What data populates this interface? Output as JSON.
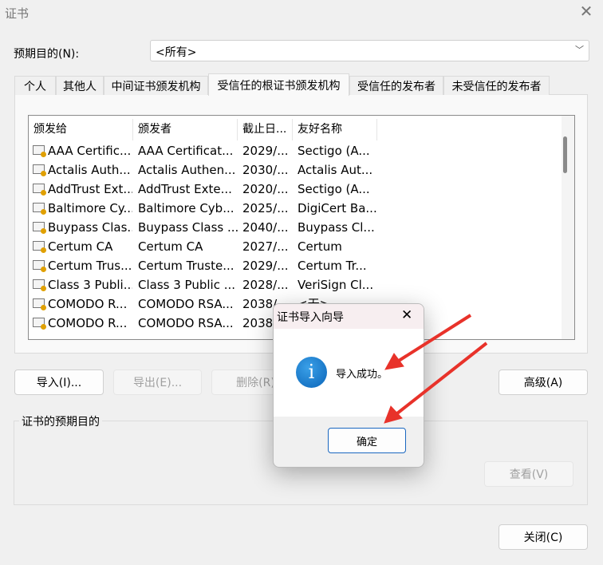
{
  "window": {
    "title": "证书",
    "close": "✕"
  },
  "purpose": {
    "label": "预期目的(N):",
    "value": "<所有>"
  },
  "tabs": [
    {
      "label": "个人"
    },
    {
      "label": "其他人"
    },
    {
      "label": "中间证书颁发机构"
    },
    {
      "label": "受信任的根证书颁发机构"
    },
    {
      "label": "受信任的发布者"
    },
    {
      "label": "未受信任的发布者"
    }
  ],
  "columns": [
    "颁发给",
    "颁发者",
    "截止日...",
    "友好名称"
  ],
  "rows": [
    [
      "AAA Certific...",
      "AAA Certificat...",
      "2029/...",
      "Sectigo (A..."
    ],
    [
      "Actalis Auth...",
      "Actalis Authen...",
      "2030/...",
      "Actalis Aut..."
    ],
    [
      "AddTrust Ext...",
      "AddTrust Exte...",
      "2020/...",
      "Sectigo (A..."
    ],
    [
      "Baltimore Cy...",
      "Baltimore Cyb...",
      "2025/...",
      "DigiCert Ba..."
    ],
    [
      "Buypass Clas...",
      "Buypass Class ...",
      "2040/...",
      "Buypass Cl..."
    ],
    [
      "Certum CA",
      "Certum CA",
      "2027/...",
      "Certum"
    ],
    [
      "Certum Trus...",
      "Certum Truste...",
      "2029/...",
      "Certum Tr..."
    ],
    [
      "Class 3 Publi...",
      "Class 3 Public ...",
      "2028/...",
      "VeriSign Cl..."
    ],
    [
      "COMODO R...",
      "COMODO RSA...",
      "2038/...",
      "<无>"
    ],
    [
      "COMODO R...",
      "COMODO RSA...",
      "2038/...",
      ""
    ]
  ],
  "buttons": {
    "import": "导入(I)...",
    "export": "导出(E)...",
    "delete": "删除(R)",
    "advanced": "高级(A)",
    "view": "查看(V)",
    "close": "关闭(C)"
  },
  "group_label": "证书的预期目的",
  "dialog": {
    "title": "证书导入向导",
    "close": "✕",
    "icon": "i",
    "message": "导入成功。",
    "ok": "确定"
  }
}
